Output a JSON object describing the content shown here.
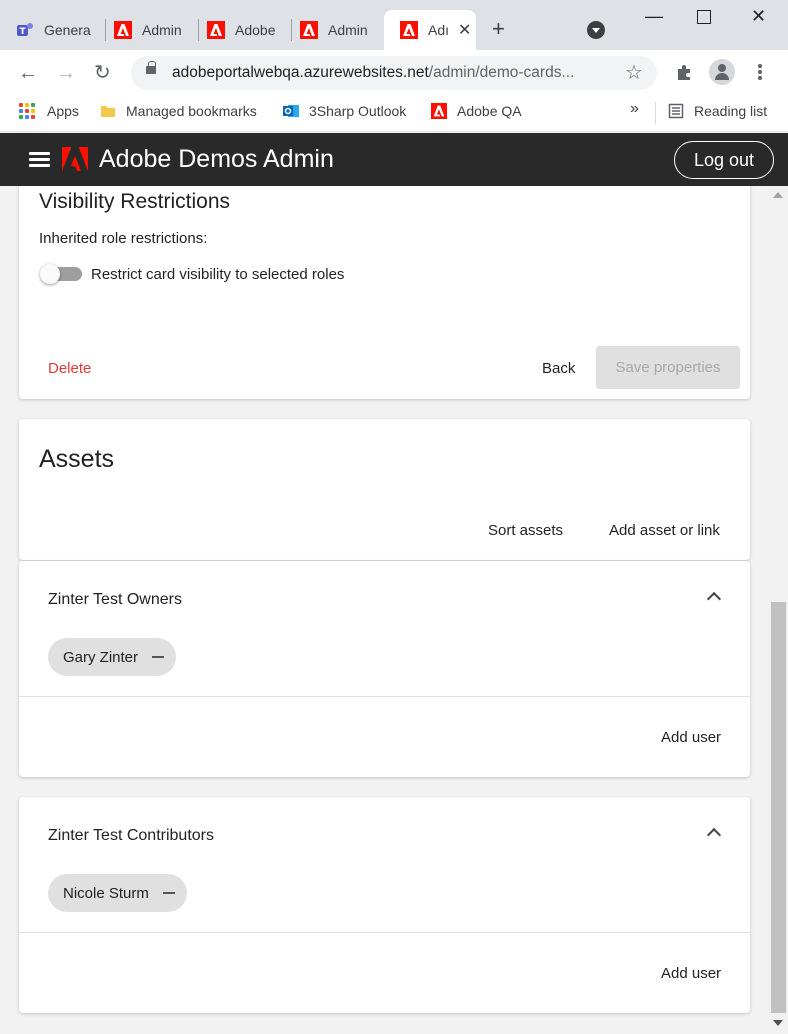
{
  "browser": {
    "tabs": [
      {
        "label": "Genera",
        "icon": "teams-icon"
      },
      {
        "label": "Admin",
        "icon": "adobe-icon"
      },
      {
        "label": "Adobe",
        "icon": "adobe-icon"
      },
      {
        "label": "Admin",
        "icon": "adobe-icon"
      },
      {
        "label": "Adı",
        "icon": "adobe-icon",
        "active": true
      }
    ],
    "url_host": "adobeportalwebqa.azurewebsites.net",
    "url_path": "/admin/demo-cards...",
    "bookmarks": {
      "apps": "Apps",
      "managed": "Managed bookmarks",
      "outlook": "3Sharp Outlook",
      "adobe_qa": "Adobe QA",
      "overflow": "»",
      "reading_list": "Reading list"
    }
  },
  "app": {
    "title": "Adobe Demos Admin",
    "logout_label": "Log out",
    "brand_color": "#fa0f00",
    "header_bg": "#292929"
  },
  "visibility": {
    "title": "Visibility Restrictions",
    "inherited_label": "Inherited role restrictions:",
    "toggle_label": "Restrict card visibility to selected roles",
    "toggle_on": false,
    "delete_label": "Delete",
    "back_label": "Back",
    "save_label": "Save properties"
  },
  "assets": {
    "title": "Assets",
    "sort_label": "Sort assets",
    "add_label": "Add asset or link"
  },
  "groups": [
    {
      "name": "Zinter Test Owners",
      "users": [
        "Gary Zinter"
      ],
      "add_user_label": "Add user"
    },
    {
      "name": "Zinter Test Contributors",
      "users": [
        "Nicole Sturm"
      ],
      "add_user_label": "Add user"
    }
  ]
}
